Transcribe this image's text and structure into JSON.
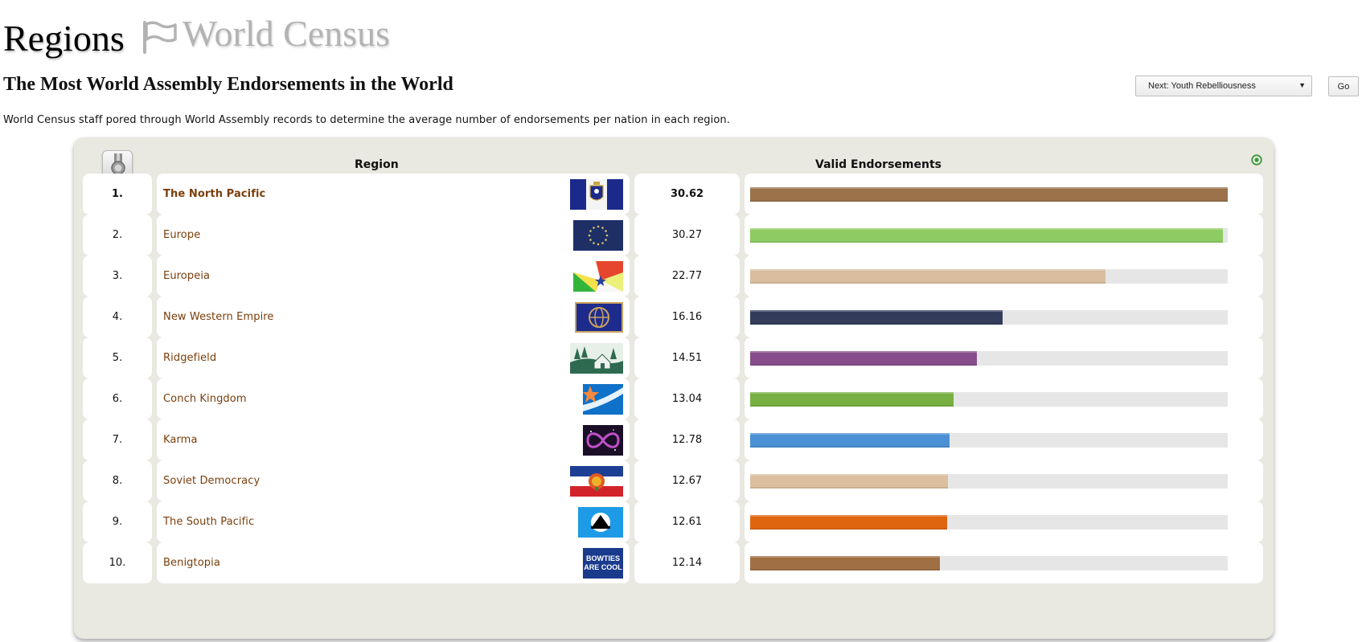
{
  "header": {
    "title": "Regions",
    "census_link": "World Census"
  },
  "census": {
    "heading": "The Most World Assembly Endorsements in the World",
    "description": "World Census staff pored through World Assembly records to determine the average number of endorsements per nation in each region.",
    "next_select": "Next: Youth Rebelliousness",
    "go_label": "Go"
  },
  "table": {
    "headers": {
      "region": "Region",
      "value": "Valid Endorsements"
    },
    "rows": [
      {
        "rank": "1.",
        "region": "The North Pacific",
        "value": "30.62",
        "fraction": 1.0,
        "color": "#9b7249",
        "flag": "flag-tnp"
      },
      {
        "rank": "2.",
        "region": "Europe",
        "value": "30.27",
        "fraction": 0.989,
        "color": "#8ccc62",
        "flag": "flag-europe"
      },
      {
        "rank": "3.",
        "region": "Europeia",
        "value": "22.77",
        "fraction": 0.744,
        "color": "#d9bd9e",
        "flag": "flag-europeia"
      },
      {
        "rank": "4.",
        "region": "New Western Empire",
        "value": "16.16",
        "fraction": 0.528,
        "color": "#333d5b",
        "flag": "flag-nwe"
      },
      {
        "rank": "5.",
        "region": "Ridgefield",
        "value": "14.51",
        "fraction": 0.474,
        "color": "#874c8c",
        "flag": "flag-ridgefield"
      },
      {
        "rank": "6.",
        "region": "Conch Kingdom",
        "value": "13.04",
        "fraction": 0.426,
        "color": "#78b043",
        "flag": "flag-conch"
      },
      {
        "rank": "7.",
        "region": "Karma",
        "value": "12.78",
        "fraction": 0.417,
        "color": "#4a90d4",
        "flag": "flag-karma"
      },
      {
        "rank": "8.",
        "region": "Soviet Democracy",
        "value": "12.67",
        "fraction": 0.414,
        "color": "#dbbf9e",
        "flag": "flag-soviet"
      },
      {
        "rank": "9.",
        "region": "The South Pacific",
        "value": "12.61",
        "fraction": 0.412,
        "color": "#e0650f",
        "flag": "flag-tsp"
      },
      {
        "rank": "10.",
        "region": "Benigtopia",
        "value": "12.14",
        "fraction": 0.397,
        "color": "#a06f43",
        "flag": "flag-benigtopia",
        "flag_text": "BOWTIES ARE COOL"
      }
    ]
  },
  "icons": {
    "census_flag": "flag-outline-icon",
    "medal": "medal-icon",
    "toggle": "collapse-toggle-icon"
  }
}
